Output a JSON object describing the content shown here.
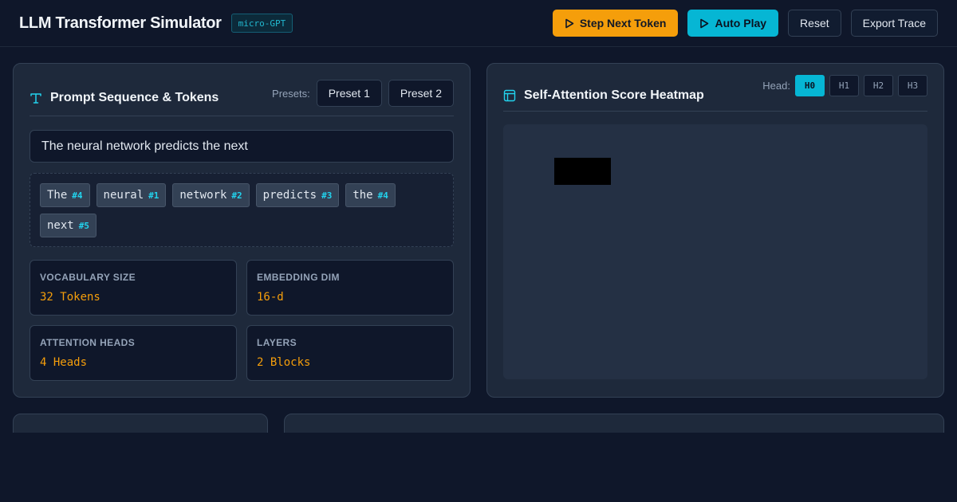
{
  "header": {
    "title": "LLM Transformer Simulator",
    "badge": "micro-GPT",
    "actions": {
      "step": "Step Next Token",
      "autoplay": "Auto Play",
      "reset": "Reset",
      "export": "Export Trace"
    }
  },
  "prompt_panel": {
    "title": "Prompt Sequence & Tokens",
    "icon": "text-icon",
    "presets_label": "Presets:",
    "presets": [
      "Preset 1",
      "Preset 2"
    ],
    "input_value": "The neural network predicts the next",
    "tokens": [
      {
        "text": "The",
        "id": "#4"
      },
      {
        "text": "neural",
        "id": "#1"
      },
      {
        "text": "network",
        "id": "#2"
      },
      {
        "text": "predicts",
        "id": "#3"
      },
      {
        "text": "the",
        "id": "#4"
      },
      {
        "text": "next",
        "id": "#5"
      }
    ],
    "stats": [
      {
        "label": "VOCABULARY SIZE",
        "value": "32 Tokens"
      },
      {
        "label": "EMBEDDING DIM",
        "value": "16-d"
      },
      {
        "label": "ATTENTION HEADS",
        "value": "4 Heads"
      },
      {
        "label": "LAYERS",
        "value": "2 Blocks"
      }
    ]
  },
  "attention_panel": {
    "title": "Self-Attention Score Heatmap",
    "icon": "layout-icon",
    "head_label": "Head:",
    "heads": [
      "H0",
      "H1",
      "H2",
      "H3"
    ],
    "active_head": "H0"
  },
  "colors": {
    "accent_orange": "#f59e0b",
    "accent_cyan": "#06b6d4",
    "background": "#0f172a",
    "panel": "#1e293b"
  }
}
